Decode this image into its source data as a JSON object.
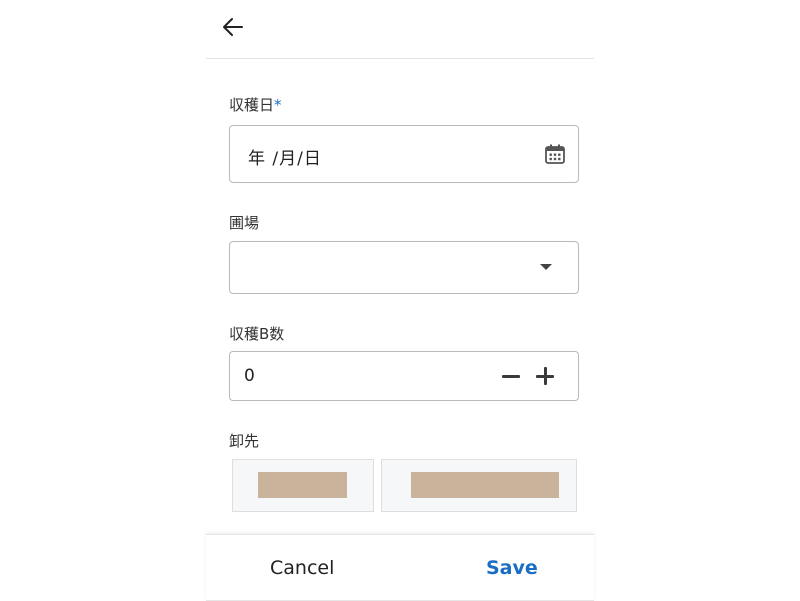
{
  "harvest_date": {
    "label": "収穫日",
    "required_mark": "*",
    "value": "年 /月/日",
    "icon": "calendar-icon"
  },
  "field": {
    "label": "圃場",
    "value": "",
    "icon": "chevron-down-icon"
  },
  "harvest_count": {
    "label": "収穫B数",
    "value": "0"
  },
  "destination": {
    "label": "卸先"
  },
  "actions": {
    "cancel": "Cancel",
    "save": "Save"
  },
  "colors": {
    "accent": "#1a6dc2",
    "chip_placeholder": "#c9b39a"
  }
}
